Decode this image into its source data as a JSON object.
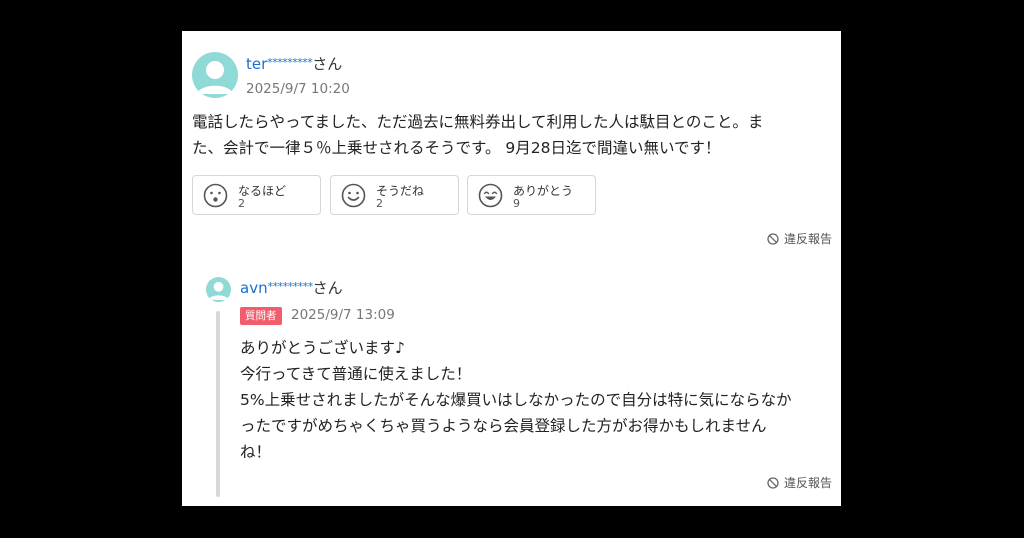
{
  "comment": {
    "username_prefix": "ter",
    "username_mask": "*********",
    "username_suffix": "さん",
    "date": "2025/9/7 10:20",
    "body_lines": [
      "電話したらやってました、ただ過去に無料券出して利用した人は駄目とのこと。ま",
      "た、会計で一律５％上乗せされるそうです。 9月28日迄で間違い無いです！"
    ],
    "reactions": [
      {
        "label": "なるほど",
        "count": "2",
        "icon": "surprised-face-icon"
      },
      {
        "label": "そうだね",
        "count": "2",
        "icon": "smile-face-icon"
      },
      {
        "label": "ありがとう",
        "count": "9",
        "icon": "grin-face-icon"
      }
    ],
    "report_label": "違反報告"
  },
  "reply": {
    "username_prefix": "avn",
    "username_mask": "*********",
    "username_suffix": "さん",
    "badge": "質問者",
    "date": "2025/9/7 13:09",
    "body_lines": [
      "ありがとうございます♪",
      "今行ってきて普通に使えました！",
      "5%上乗せされましたがそんな爆買いはしなかったので自分は特に気にならなか",
      "ったですがめちゃくちゃ買うようなら会員登録した方がお得かもしれません",
      "ね！"
    ],
    "report_label": "違反報告"
  },
  "colors": {
    "username": "#1a6fd0",
    "avatar": "#8fd9d6",
    "badge": "#f25c6c"
  }
}
